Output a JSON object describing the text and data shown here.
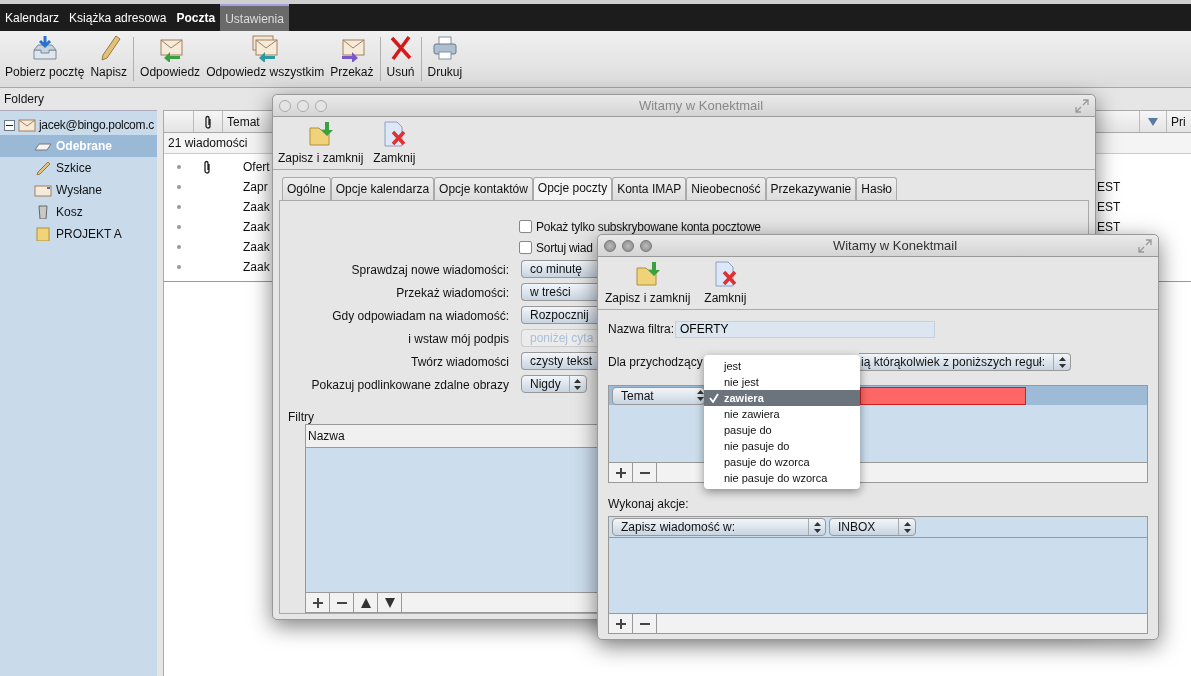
{
  "app_tabs": [
    {
      "label": "Kalendarz",
      "selected": false,
      "highlighted": false
    },
    {
      "label": "Książka adresowa",
      "selected": false,
      "highlighted": false
    },
    {
      "label": "Poczta",
      "selected": true,
      "highlighted": false
    },
    {
      "label": "Ustawienia",
      "selected": false,
      "highlighted": true
    }
  ],
  "toolbar": [
    {
      "buttons": [
        {
          "kind": "fetch",
          "label": "Pobierz pocztę"
        },
        {
          "kind": "compose",
          "label": "Napisz"
        }
      ]
    },
    {
      "buttons": [
        {
          "kind": "reply",
          "label": "Odpowiedz"
        },
        {
          "kind": "reply_all",
          "label": "Odpowiedz wszystkim"
        },
        {
          "kind": "forward",
          "label": "Przekaż"
        }
      ]
    },
    {
      "buttons": [
        {
          "kind": "delete",
          "label": "Usuń"
        }
      ]
    },
    {
      "buttons": [
        {
          "kind": "print",
          "label": "Drukuj"
        }
      ]
    }
  ],
  "folders": {
    "title": "Foldery",
    "account": {
      "label": "jacek@bingo.polcom.c",
      "expanded": true,
      "children": [
        {
          "label": "Odebrane",
          "kind": "inbox",
          "selected": true
        },
        {
          "label": "Szkice",
          "kind": "drafts",
          "selected": false
        },
        {
          "label": "Wysłane",
          "kind": "sent",
          "selected": false
        },
        {
          "label": "Kosz",
          "kind": "trash",
          "selected": false
        },
        {
          "label": "PROJEKT A",
          "kind": "folder",
          "selected": false
        }
      ]
    }
  },
  "message_list": {
    "subject_column": "Temat",
    "column_5": "Pri",
    "count": "21 wiadomości",
    "rows": [
      {
        "subject": "Ofert",
        "attachment": true
      },
      {
        "subject": "Zapr",
        "attachment": false,
        "column_4": "EST"
      },
      {
        "subject": "Zaak",
        "attachment": false,
        "column_4": "EST"
      },
      {
        "subject": "Zaak",
        "attachment": false,
        "column_4": "EST"
      },
      {
        "subject": "Zaak",
        "attachment": false
      },
      {
        "subject": "Zaak",
        "attachment": false
      }
    ]
  },
  "settings_window": {
    "title": "Witamy w Konektmail",
    "active": false,
    "toolbar": [
      {
        "kind": "save",
        "label": "Zapisz i zamknij"
      },
      {
        "kind": "close",
        "label": "Zamknij"
      }
    ],
    "tabs": [
      {
        "label": "Ogólne",
        "selected": false
      },
      {
        "label": "Opcje kalendarza",
        "selected": false
      },
      {
        "label": "Opcje kontaktów",
        "selected": false
      },
      {
        "label": "Opcje poczty",
        "selected": true
      },
      {
        "label": "Konta IMAP",
        "selected": false
      },
      {
        "label": "Nieobecność",
        "selected": false
      },
      {
        "label": "Przekazywanie",
        "selected": false
      },
      {
        "label": "Hasło",
        "selected": false
      }
    ],
    "checkboxes": [
      {
        "label": "Pokaż tylko subskrybowane konta pocztowe",
        "checked": false
      },
      {
        "label": "Sortuj wiad",
        "checked": false
      }
    ],
    "fields": [
      {
        "label": "Sprawdzaj nowe wiadomości:",
        "value": "co minutę",
        "disabled": false,
        "stepper": false
      },
      {
        "label": "Przekaż wiadomości:",
        "value": "w treści",
        "disabled": false,
        "stepper": false
      },
      {
        "label": "Gdy odpowiadam na wiadomość:",
        "value": "Rozpocznij",
        "disabled": false,
        "stepper": false
      },
      {
        "label": "i wstaw mój podpis",
        "value": "poniżej cyta",
        "disabled": true,
        "stepper": false
      },
      {
        "label": "Twórz wiadomości",
        "value": "czysty tekst",
        "disabled": false,
        "stepper": false
      },
      {
        "label": "Pokazuj podlinkowane zdalne obrazy",
        "value": "Nigdy",
        "disabled": false,
        "stepper": true
      }
    ],
    "filters": {
      "title": "Filtry",
      "column": "Nazwa"
    }
  },
  "filter_window": {
    "title": "Witamy w Konektmail",
    "active": true,
    "toolbar": [
      {
        "kind": "save",
        "label": "Zapisz i zamknij"
      },
      {
        "kind": "close",
        "label": "Zamknij"
      }
    ],
    "name_label": "Nazwa filtra:",
    "name_value": "OFERTY",
    "match_label": "Dla przychodzący",
    "match_value": "ią którąkolwiek z poniższych reguł:",
    "rules": [
      {
        "field": "Temat",
        "invalid": true
      }
    ],
    "actions_label": "Wykonaj akcje:",
    "actions": [
      {
        "action": "Zapisz wiadomość w:",
        "target": "INBOX"
      }
    ]
  },
  "condition_menu": [
    {
      "label": "jest",
      "selected": false
    },
    {
      "label": "nie jest",
      "selected": false
    },
    {
      "label": "zawiera",
      "selected": true
    },
    {
      "label": "nie zawiera",
      "selected": false
    },
    {
      "label": "pasuje do",
      "selected": false
    },
    {
      "label": "nie pasuje do",
      "selected": false
    },
    {
      "label": "pasuje do wzorca",
      "selected": false
    },
    {
      "label": "nie pasuje do wzorca",
      "selected": false
    }
  ]
}
